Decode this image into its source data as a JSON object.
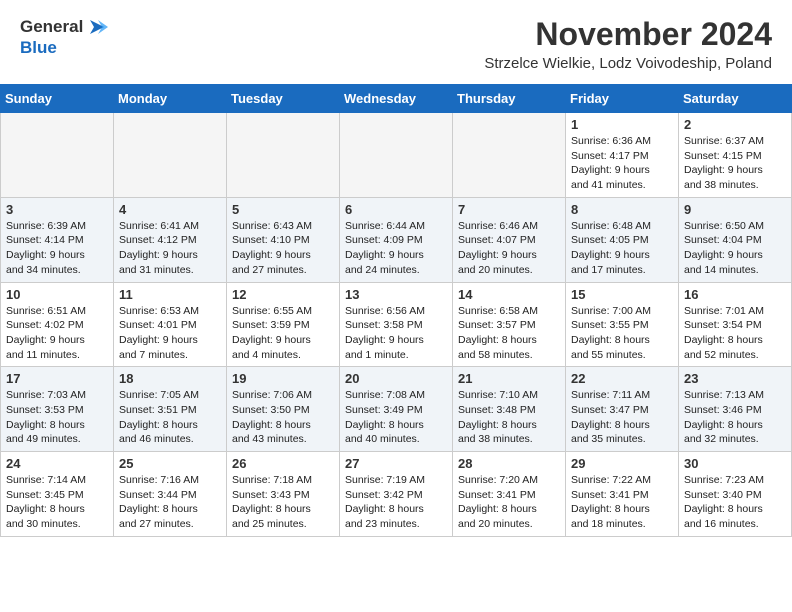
{
  "logo": {
    "text_general": "General",
    "text_blue": "Blue"
  },
  "title": "November 2024",
  "subtitle": "Strzelce Wielkie, Lodz Voivodeship, Poland",
  "header_days": [
    "Sunday",
    "Monday",
    "Tuesday",
    "Wednesday",
    "Thursday",
    "Friday",
    "Saturday"
  ],
  "weeks": [
    {
      "days": [
        {
          "num": "",
          "info": ""
        },
        {
          "num": "",
          "info": ""
        },
        {
          "num": "",
          "info": ""
        },
        {
          "num": "",
          "info": ""
        },
        {
          "num": "",
          "info": ""
        },
        {
          "num": "1",
          "info": "Sunrise: 6:36 AM\nSunset: 4:17 PM\nDaylight: 9 hours\nand 41 minutes."
        },
        {
          "num": "2",
          "info": "Sunrise: 6:37 AM\nSunset: 4:15 PM\nDaylight: 9 hours\nand 38 minutes."
        }
      ]
    },
    {
      "days": [
        {
          "num": "3",
          "info": "Sunrise: 6:39 AM\nSunset: 4:14 PM\nDaylight: 9 hours\nand 34 minutes."
        },
        {
          "num": "4",
          "info": "Sunrise: 6:41 AM\nSunset: 4:12 PM\nDaylight: 9 hours\nand 31 minutes."
        },
        {
          "num": "5",
          "info": "Sunrise: 6:43 AM\nSunset: 4:10 PM\nDaylight: 9 hours\nand 27 minutes."
        },
        {
          "num": "6",
          "info": "Sunrise: 6:44 AM\nSunset: 4:09 PM\nDaylight: 9 hours\nand 24 minutes."
        },
        {
          "num": "7",
          "info": "Sunrise: 6:46 AM\nSunset: 4:07 PM\nDaylight: 9 hours\nand 20 minutes."
        },
        {
          "num": "8",
          "info": "Sunrise: 6:48 AM\nSunset: 4:05 PM\nDaylight: 9 hours\nand 17 minutes."
        },
        {
          "num": "9",
          "info": "Sunrise: 6:50 AM\nSunset: 4:04 PM\nDaylight: 9 hours\nand 14 minutes."
        }
      ]
    },
    {
      "days": [
        {
          "num": "10",
          "info": "Sunrise: 6:51 AM\nSunset: 4:02 PM\nDaylight: 9 hours\nand 11 minutes."
        },
        {
          "num": "11",
          "info": "Sunrise: 6:53 AM\nSunset: 4:01 PM\nDaylight: 9 hours\nand 7 minutes."
        },
        {
          "num": "12",
          "info": "Sunrise: 6:55 AM\nSunset: 3:59 PM\nDaylight: 9 hours\nand 4 minutes."
        },
        {
          "num": "13",
          "info": "Sunrise: 6:56 AM\nSunset: 3:58 PM\nDaylight: 9 hours\nand 1 minute."
        },
        {
          "num": "14",
          "info": "Sunrise: 6:58 AM\nSunset: 3:57 PM\nDaylight: 8 hours\nand 58 minutes."
        },
        {
          "num": "15",
          "info": "Sunrise: 7:00 AM\nSunset: 3:55 PM\nDaylight: 8 hours\nand 55 minutes."
        },
        {
          "num": "16",
          "info": "Sunrise: 7:01 AM\nSunset: 3:54 PM\nDaylight: 8 hours\nand 52 minutes."
        }
      ]
    },
    {
      "days": [
        {
          "num": "17",
          "info": "Sunrise: 7:03 AM\nSunset: 3:53 PM\nDaylight: 8 hours\nand 49 minutes."
        },
        {
          "num": "18",
          "info": "Sunrise: 7:05 AM\nSunset: 3:51 PM\nDaylight: 8 hours\nand 46 minutes."
        },
        {
          "num": "19",
          "info": "Sunrise: 7:06 AM\nSunset: 3:50 PM\nDaylight: 8 hours\nand 43 minutes."
        },
        {
          "num": "20",
          "info": "Sunrise: 7:08 AM\nSunset: 3:49 PM\nDaylight: 8 hours\nand 40 minutes."
        },
        {
          "num": "21",
          "info": "Sunrise: 7:10 AM\nSunset: 3:48 PM\nDaylight: 8 hours\nand 38 minutes."
        },
        {
          "num": "22",
          "info": "Sunrise: 7:11 AM\nSunset: 3:47 PM\nDaylight: 8 hours\nand 35 minutes."
        },
        {
          "num": "23",
          "info": "Sunrise: 7:13 AM\nSunset: 3:46 PM\nDaylight: 8 hours\nand 32 minutes."
        }
      ]
    },
    {
      "days": [
        {
          "num": "24",
          "info": "Sunrise: 7:14 AM\nSunset: 3:45 PM\nDaylight: 8 hours\nand 30 minutes."
        },
        {
          "num": "25",
          "info": "Sunrise: 7:16 AM\nSunset: 3:44 PM\nDaylight: 8 hours\nand 27 minutes."
        },
        {
          "num": "26",
          "info": "Sunrise: 7:18 AM\nSunset: 3:43 PM\nDaylight: 8 hours\nand 25 minutes."
        },
        {
          "num": "27",
          "info": "Sunrise: 7:19 AM\nSunset: 3:42 PM\nDaylight: 8 hours\nand 23 minutes."
        },
        {
          "num": "28",
          "info": "Sunrise: 7:20 AM\nSunset: 3:41 PM\nDaylight: 8 hours\nand 20 minutes."
        },
        {
          "num": "29",
          "info": "Sunrise: 7:22 AM\nSunset: 3:41 PM\nDaylight: 8 hours\nand 18 minutes."
        },
        {
          "num": "30",
          "info": "Sunrise: 7:23 AM\nSunset: 3:40 PM\nDaylight: 8 hours\nand 16 minutes."
        }
      ]
    }
  ]
}
